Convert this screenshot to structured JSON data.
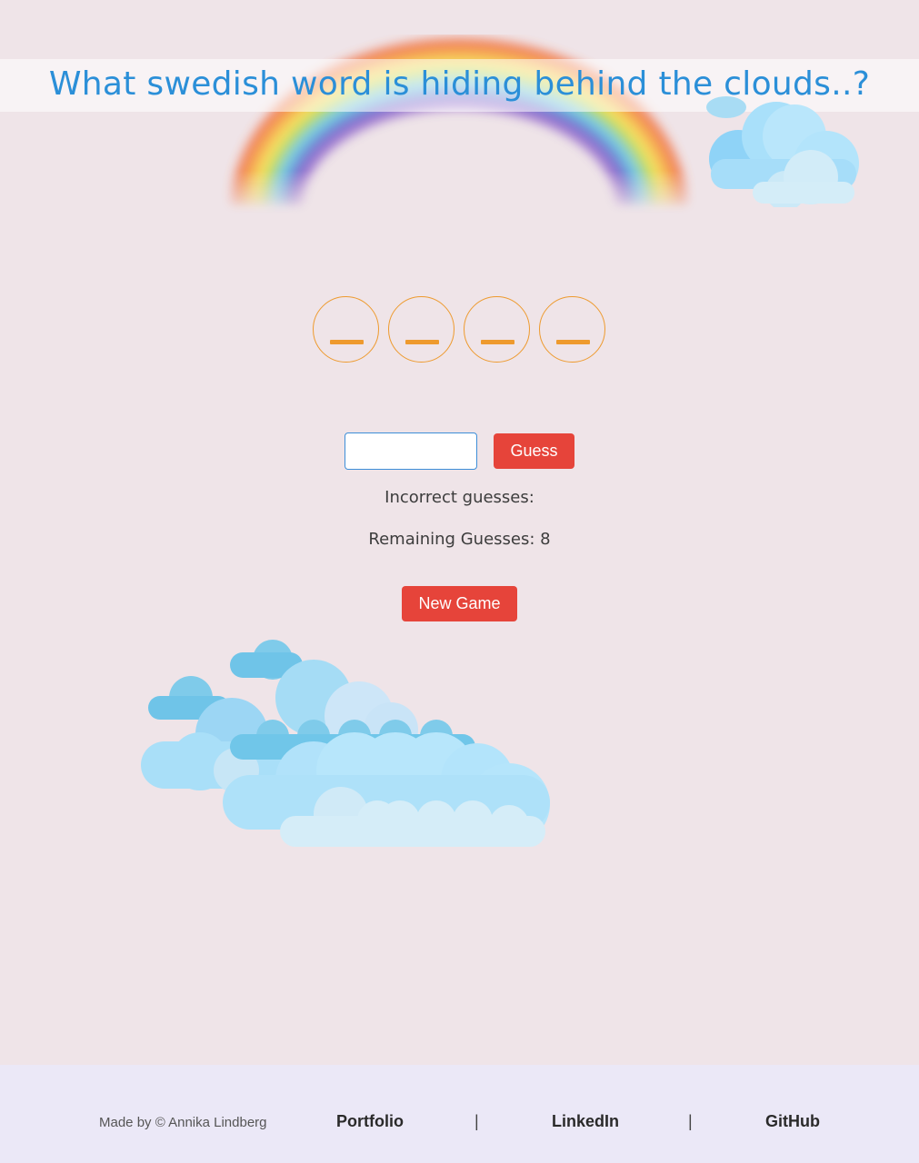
{
  "header": {
    "title": "What swedish word is hiding behind the clouds..?"
  },
  "decorations": {
    "rainbow": "rainbow-image",
    "clouds": [
      "cloud-top-right",
      "cloud-cluster-bottom-left"
    ]
  },
  "game": {
    "slots": [
      "_",
      "_",
      "_",
      "_"
    ],
    "guess_input_value": "",
    "guess_input_placeholder": "",
    "guess_button_label": "Guess",
    "incorrect_label": "Incorrect guesses:",
    "remaining_label": "Remaining Guesses: 8",
    "new_game_label": "New Game"
  },
  "colors": {
    "background": "#efe4e8",
    "title": "#2b8fd8",
    "slot_accent": "#ee9a2e",
    "button": "#e6443a",
    "footer_background": "#ebe8f7"
  },
  "footer": {
    "made_by": "Made by © Annika Lindberg",
    "links": [
      "Portfolio",
      "LinkedIn",
      "GitHub"
    ],
    "separator": "|"
  }
}
